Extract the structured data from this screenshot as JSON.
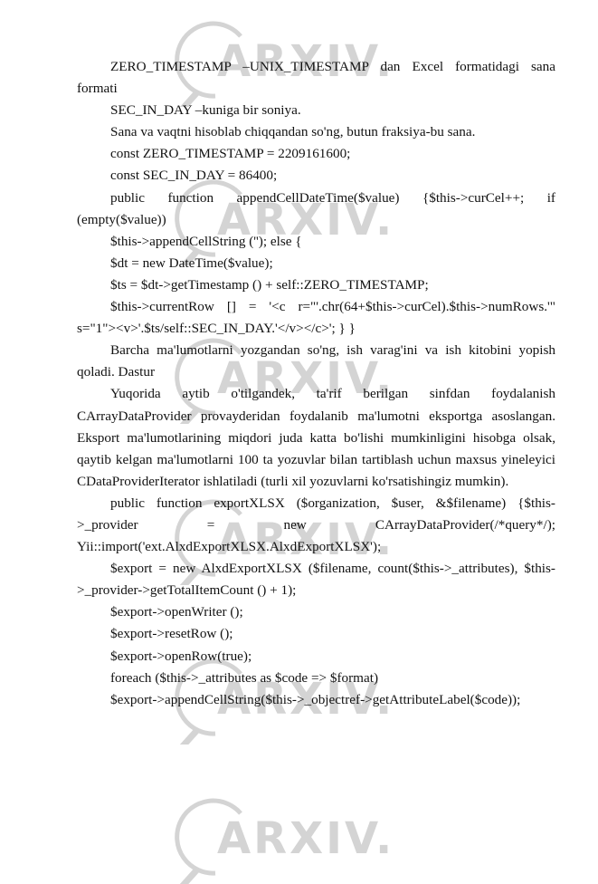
{
  "watermark": {
    "text": "ARXIV.UZ",
    "icon": "magnifier-logo-icon",
    "color": "#d4d4d4"
  },
  "document": {
    "paragraphs": [
      "ZERO_TIMESTAMP –UNIX_TIMESTAMP dan Excel formatidagi sana formati",
      "SEC_IN_DAY –kuniga bir soniya.",
      "Sana va vaqtni hisoblab chiqqandan so'ng, butun fraksiya-bu sana.",
      "const ZERO_TIMESTAMP = 2209161600;",
      "const SEC_IN_DAY = 86400;",
      "public function appendCellDateTime($value) {$this->curCel++; if (empty($value))",
      "$this->appendCellString (''); else {",
      "$dt = new DateTime($value);",
      "$ts = $dt->getTimestamp () + self::ZERO_TIMESTAMP;",
      "$this->currentRow [] = '<c r=\"'.chr(64+$this->curCel).$this->numRows.'\" s=\"1\"><v>'.$ts/self::SEC_IN_DAY.'</v></c>'; } }",
      "Barcha ma'lumotlarni yozgandan so'ng, ish varag'ini va ish kitobini yopish qoladi. Dastur",
      "Yuqorida aytib o'tilgandek, ta'rif berilgan sinfdan foydalanish CArrayDataProvider provayderidan foydalanib ma'lumotni eksportga asoslangan. Eksport ma'lumotlarining miqdori juda katta bo'lishi mumkinligini hisobga olsak, qaytib kelgan ma'lumotlarni 100 ta yozuvlar bilan tartiblash uchun maxsus yineleyici CDataProviderIterator ishlatiladi (turli xil yozuvlarni ko'rsatishingiz mumkin).",
      "public function exportXLSX ($organization, $user, &$filename) {$this->_provider = new CArrayDataProvider(/*query*/); Yii::import('ext.AlxdExportXLSX.AlxdExportXLSX');",
      "$export = new AlxdExportXLSX ($filename, count($this->_attributes), $this->_provider->getTotalItemCount () + 1);",
      "$export->openWriter ();",
      "$export->resetRow ();",
      "$export->openRow(true);",
      "foreach ($this->_attributes as $code => $format)",
      "$export->appendCellString($this->_objectref->getAttributeLabel($code));"
    ]
  }
}
